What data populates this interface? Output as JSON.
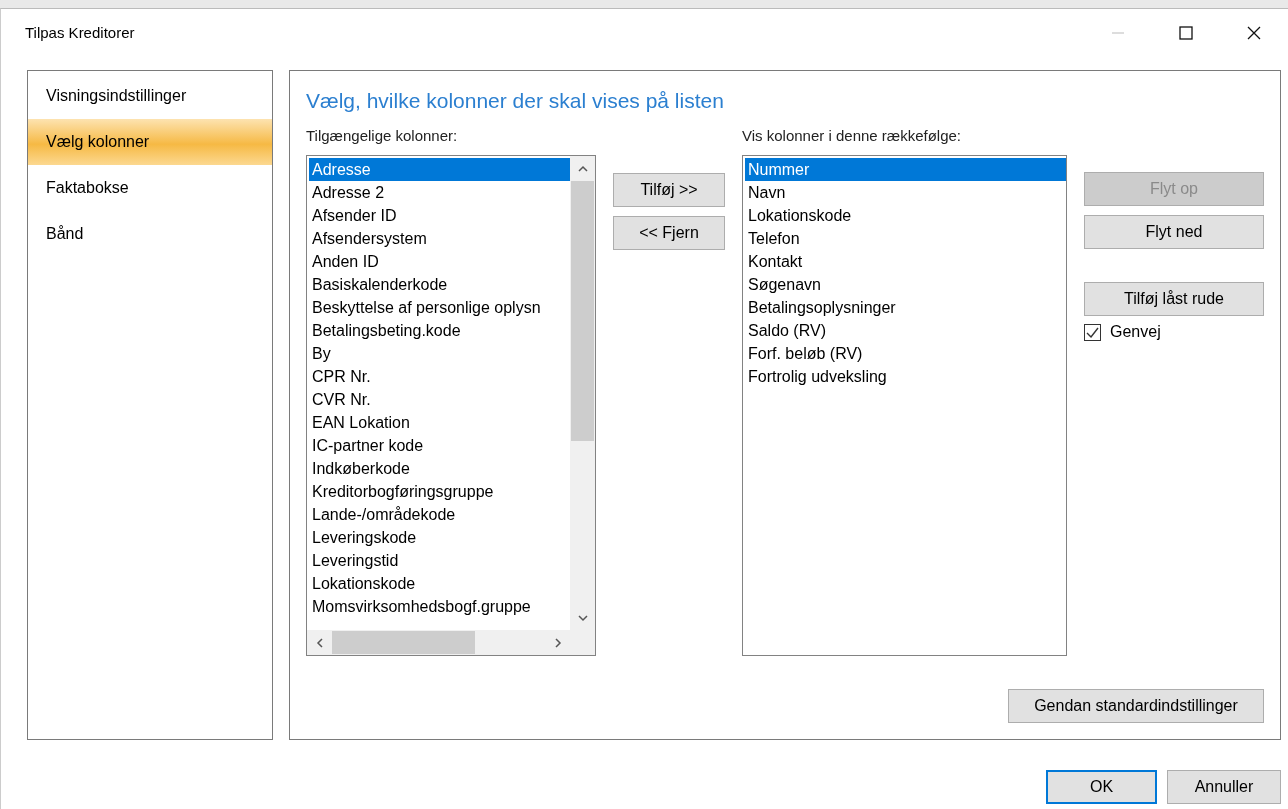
{
  "window": {
    "title": "Tilpas Kreditorer"
  },
  "sidebar": {
    "items": [
      {
        "label": "Visningsindstillinger",
        "selected": false
      },
      {
        "label": "Vælg kolonner",
        "selected": true
      },
      {
        "label": "Faktabokse",
        "selected": false
      },
      {
        "label": "Bånd",
        "selected": false
      }
    ]
  },
  "heading": "Vælg, hvilke kolonner der skal vises på listen",
  "available": {
    "label": "Tilgængelige kolonner:",
    "items": [
      {
        "label": "Adresse",
        "selected": true
      },
      {
        "label": "Adresse 2",
        "selected": false
      },
      {
        "label": "Afsender ID",
        "selected": false
      },
      {
        "label": "Afsendersystem",
        "selected": false
      },
      {
        "label": "Anden ID",
        "selected": false
      },
      {
        "label": "Basiskalenderkode",
        "selected": false
      },
      {
        "label": "Beskyttelse af personlige oplysn",
        "selected": false
      },
      {
        "label": "Betalingsbeting.kode",
        "selected": false
      },
      {
        "label": "By",
        "selected": false
      },
      {
        "label": "CPR Nr.",
        "selected": false
      },
      {
        "label": "CVR Nr.",
        "selected": false
      },
      {
        "label": "EAN Lokation",
        "selected": false
      },
      {
        "label": "IC-partner kode",
        "selected": false
      },
      {
        "label": "Indkøberkode",
        "selected": false
      },
      {
        "label": "Kreditorbogføringsgruppe",
        "selected": false
      },
      {
        "label": "Lande-/områdekode",
        "selected": false
      },
      {
        "label": "Leveringskode",
        "selected": false
      },
      {
        "label": "Leveringstid",
        "selected": false
      },
      {
        "label": "Lokationskode",
        "selected": false
      },
      {
        "label": "Momsvirksomhedsbogf.gruppe",
        "selected": false
      }
    ]
  },
  "move_buttons": [
    {
      "label": "Tilføj >>",
      "disabled": false
    },
    {
      "label": "<< Fjern",
      "disabled": false
    }
  ],
  "shown": {
    "label": "Vis kolonner i denne rækkefølge:",
    "items": [
      {
        "label": "Nummer",
        "selected": true
      },
      {
        "label": "Navn",
        "selected": false
      },
      {
        "label": "Lokationskode",
        "selected": false
      },
      {
        "label": "Telefon",
        "selected": false
      },
      {
        "label": "Kontakt",
        "selected": false
      },
      {
        "label": "Søgenavn",
        "selected": false
      },
      {
        "label": "Betalingsoplysninger",
        "selected": false
      },
      {
        "label": "Saldo (RV)",
        "selected": false
      },
      {
        "label": "Forf. beløb (RV)",
        "selected": false
      },
      {
        "label": "Fortrolig udveksling",
        "selected": false
      }
    ]
  },
  "order_buttons": [
    {
      "label": "Flyt op",
      "disabled": true
    },
    {
      "label": "Flyt ned",
      "disabled": false
    }
  ],
  "lock_button": {
    "label": "Tilføj låst rude",
    "disabled": false
  },
  "shortcut": {
    "label": "Genvej",
    "checked": true
  },
  "reset_button": {
    "label": "Gendan standardindstillinger",
    "disabled": false
  },
  "footer_buttons": [
    {
      "label": "OK",
      "default": true
    },
    {
      "label": "Annuller",
      "default": false
    }
  ]
}
